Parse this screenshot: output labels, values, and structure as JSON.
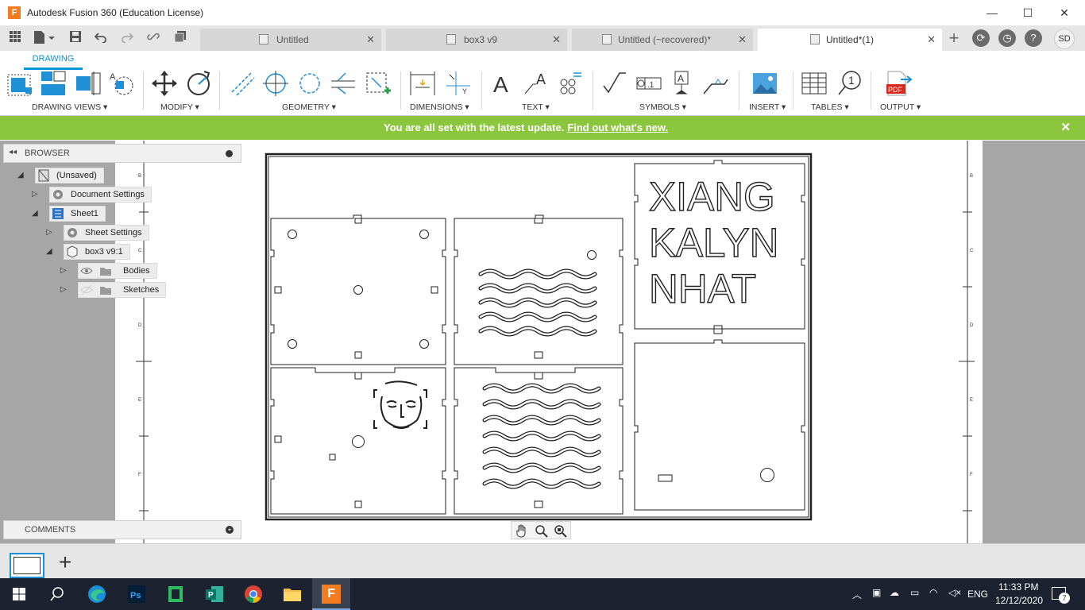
{
  "window": {
    "title": "Autodesk Fusion 360 (Education License)",
    "minimize": "—",
    "maximize": "☐",
    "close": "✕"
  },
  "tabs": [
    {
      "label": "Untitled",
      "close": "✕"
    },
    {
      "label": "box3 v9",
      "close": "✕"
    },
    {
      "label": "Untitled (~recovered)*",
      "close": "✕"
    },
    {
      "label": "Untitled*(1)",
      "close": "✕",
      "active": true
    }
  ],
  "topbar": {
    "user_initials": "SD",
    "new_tab": "+"
  },
  "ribbon": {
    "workspace_tab": "DRAWING",
    "groups": {
      "drawing_views": "DRAWING VIEWS ▾",
      "modify": "MODIFY ▾",
      "geometry": "GEOMETRY ▾",
      "dimensions": "DIMENSIONS ▾",
      "text": "TEXT ▾",
      "symbols": "SYMBOLS ▾",
      "insert": "INSERT ▾",
      "tables": "TABLES ▾",
      "output": "OUTPUT ▾"
    },
    "pdf_label": "PDF",
    "balloon_number": "1"
  },
  "banner": {
    "message": "You are all set with the latest update.",
    "link": "Find out what's new.",
    "close": "✕"
  },
  "browser": {
    "header": "BROWSER",
    "items": [
      {
        "label": "(Unsaved)"
      },
      {
        "label": "Document Settings"
      },
      {
        "label": "Sheet1"
      },
      {
        "label": "Sheet Settings"
      },
      {
        "label": "box3 v9:1"
      },
      {
        "label": "Bodies"
      },
      {
        "label": "Sketches"
      }
    ]
  },
  "comments": {
    "header": "COMMENTS"
  },
  "sheet": {
    "border_letters": [
      "B",
      "C",
      "D",
      "E",
      "F"
    ],
    "engraving": {
      "line1": "XIANG",
      "line2": "KALYN",
      "line3": "NHAT"
    }
  },
  "bottom": {
    "add_sheet": "+"
  },
  "taskbar": {
    "language": "ENG",
    "time": "11:33 PM",
    "date": "12/12/2020",
    "notifications": "7"
  },
  "colors": {
    "accent": "#0696d7",
    "banner": "#8cc63f",
    "fusion_orange": "#f37b21"
  }
}
